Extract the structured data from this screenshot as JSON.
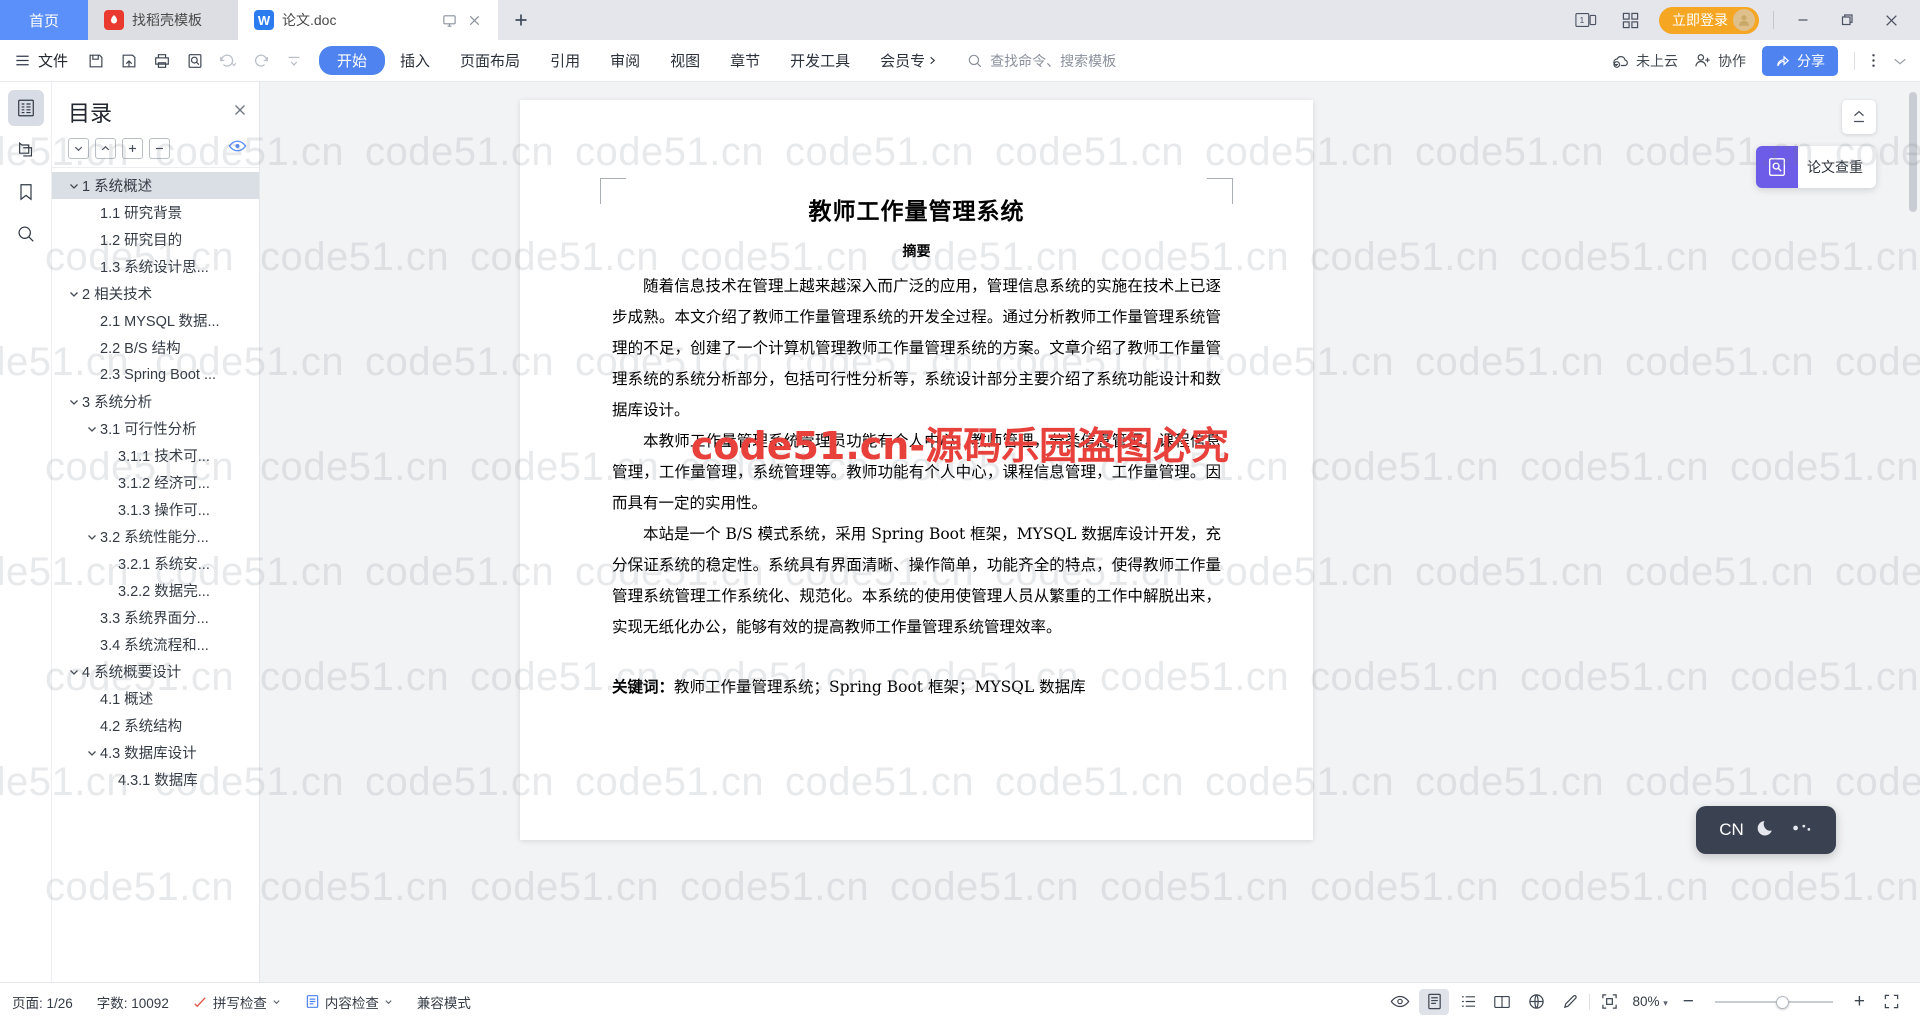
{
  "window": {
    "tabs": [
      {
        "label": "首页",
        "type": "home"
      },
      {
        "label": "找稻壳模板",
        "type": "template",
        "icon": "docer-icon"
      },
      {
        "label": "论文.doc",
        "type": "document",
        "icon": "writer-icon"
      }
    ],
    "new_tab_label": "+",
    "controls": {
      "screens_label": "1",
      "grid_label": "grid-icon",
      "login_label": "立即登录",
      "minimize": "−",
      "maximize": "❐",
      "close": "✕"
    }
  },
  "ribbon": {
    "file_label": "文件",
    "quick_access": [
      "save-icon",
      "save-as-icon",
      "print-icon",
      "print-preview-icon",
      "undo-icon",
      "redo-icon",
      "customize-icon"
    ],
    "menus": [
      {
        "label": "开始",
        "active": true
      },
      {
        "label": "插入",
        "active": false
      },
      {
        "label": "页面布局",
        "active": false
      },
      {
        "label": "引用",
        "active": false
      },
      {
        "label": "审阅",
        "active": false
      },
      {
        "label": "视图",
        "active": false
      },
      {
        "label": "章节",
        "active": false
      },
      {
        "label": "开发工具",
        "active": false
      }
    ],
    "vip_label": "会员专",
    "search_placeholder": "查找命令、搜索模板",
    "cloud_status": "未上云",
    "collaborate": "协作",
    "share": "分享",
    "more": "⋮"
  },
  "rail": {
    "items": [
      {
        "name": "toc-icon",
        "selected": true
      },
      {
        "name": "thumbnail-icon",
        "selected": false
      },
      {
        "name": "bookmark-icon",
        "selected": false
      },
      {
        "name": "search-icon",
        "selected": false
      }
    ]
  },
  "toc": {
    "title": "目录",
    "close_label": "✕",
    "tools": [
      "expand-down-icon",
      "collapse-up-icon",
      "add-level-icon",
      "remove-level-icon"
    ],
    "eye_icon": "eye-icon",
    "items": [
      {
        "label": "1 系统概述",
        "indent": 0,
        "caret": "down",
        "selected": true
      },
      {
        "label": "1.1  研究背景",
        "indent": 1,
        "caret": "none",
        "selected": false
      },
      {
        "label": "1.2 研究目的",
        "indent": 1,
        "caret": "none",
        "selected": false
      },
      {
        "label": "1.3 系统设计思...",
        "indent": 1,
        "caret": "none",
        "selected": false
      },
      {
        "label": "2 相关技术",
        "indent": 0,
        "caret": "down",
        "selected": false
      },
      {
        "label": "2.1 MYSQL 数据...",
        "indent": 1,
        "caret": "none",
        "selected": false
      },
      {
        "label": "2.2 B/S 结构",
        "indent": 1,
        "caret": "none",
        "selected": false
      },
      {
        "label": "2.3 Spring Boot ...",
        "indent": 1,
        "caret": "none",
        "selected": false
      },
      {
        "label": "3 系统分析",
        "indent": 0,
        "caret": "down",
        "selected": false
      },
      {
        "label": "3.1 可行性分析",
        "indent": 1,
        "caret": "down",
        "selected": false
      },
      {
        "label": "3.1.1 技术可...",
        "indent": 2,
        "caret": "none",
        "selected": false
      },
      {
        "label": "3.1.2 经济可...",
        "indent": 2,
        "caret": "none",
        "selected": false
      },
      {
        "label": "3.1.3 操作可...",
        "indent": 2,
        "caret": "none",
        "selected": false
      },
      {
        "label": "3.2 系统性能分...",
        "indent": 1,
        "caret": "down",
        "selected": false
      },
      {
        "label": "3.2.1 系统安...",
        "indent": 2,
        "caret": "none",
        "selected": false
      },
      {
        "label": "3.2.2 数据完...",
        "indent": 2,
        "caret": "none",
        "selected": false
      },
      {
        "label": "3.3 系统界面分...",
        "indent": 1,
        "caret": "none",
        "selected": false
      },
      {
        "label": "3.4 系统流程和...",
        "indent": 1,
        "caret": "none",
        "selected": false
      },
      {
        "label": "4 系统概要设计",
        "indent": 0,
        "caret": "down",
        "selected": false
      },
      {
        "label": "4.1 概述",
        "indent": 1,
        "caret": "none",
        "selected": false
      },
      {
        "label": "4.2 系统结构",
        "indent": 1,
        "caret": "none",
        "selected": false
      },
      {
        "label": "4.3 数据库设计",
        "indent": 1,
        "caret": "down",
        "selected": false
      },
      {
        "label": "4.3.1 数据库",
        "indent": 2,
        "caret": "none",
        "selected": false
      }
    ]
  },
  "document": {
    "title": "教师工作量管理系统",
    "subtitle": "摘要",
    "paragraphs": [
      "随着信息技术在管理上越来越深入而广泛的应用，管理信息系统的实施在技术上已逐步成熟。本文介绍了教师工作量管理系统的开发全过程。通过分析教师工作量管理系统管理的不足，创建了一个计算机管理教师工作量管理系统的方案。文章介绍了教师工作量管理系统的系统分析部分，包括可行性分析等，系统设计部分主要介绍了系统功能设计和数据库设计。",
      "本教师工作量管理系统管理员功能有个人中心，教师管理，分类信息管理，课程信息管理，工作量管理，系统管理等。教师功能有个人中心，课程信息管理，工作量管理。因而具有一定的实用性。",
      "本站是一个 B/S 模式系统，采用 Spring Boot 框架，MYSQL 数据库设计开发，充分保证系统的稳定性。系统具有界面清晰、操作简单，功能齐全的特点，使得教师工作量管理系统管理工作系统化、规范化。本系统的使用使管理人员从繁重的工作中解脱出来，实现无纸化办公，能够有效的提高教师工作量管理系统管理效率。"
    ],
    "keywords_label": "关键词：",
    "keywords_value": "教师工作量管理系统；Spring Boot 框架；MYSQL 数据库"
  },
  "floating": {
    "page_nav_icon": "page-updown-icon",
    "paper_check_label": "论文查重",
    "ime": {
      "lang": "CN",
      "moon_icon": "moon-icon",
      "dots_icon": "dots-icon"
    }
  },
  "watermark": {
    "tile_text": "code51.cn",
    "center_text": "code51.cn-源码乐园盗图必究"
  },
  "status": {
    "page_label": "页面: 1/26",
    "word_count_label": "字数: 10092",
    "spell_check": "拼写检查",
    "content_check": "内容检查",
    "compat_mode": "兼容模式",
    "view_icons": [
      "eye-review-icon",
      "page-view-icon",
      "outline-view-icon",
      "read-view-icon",
      "web-view-icon",
      "edit-pen-icon",
      "fullscreen-icon"
    ],
    "zoom_label": "80%",
    "zoom_out": "−",
    "zoom_in": "+",
    "fit_icon": "fit-page-icon"
  }
}
